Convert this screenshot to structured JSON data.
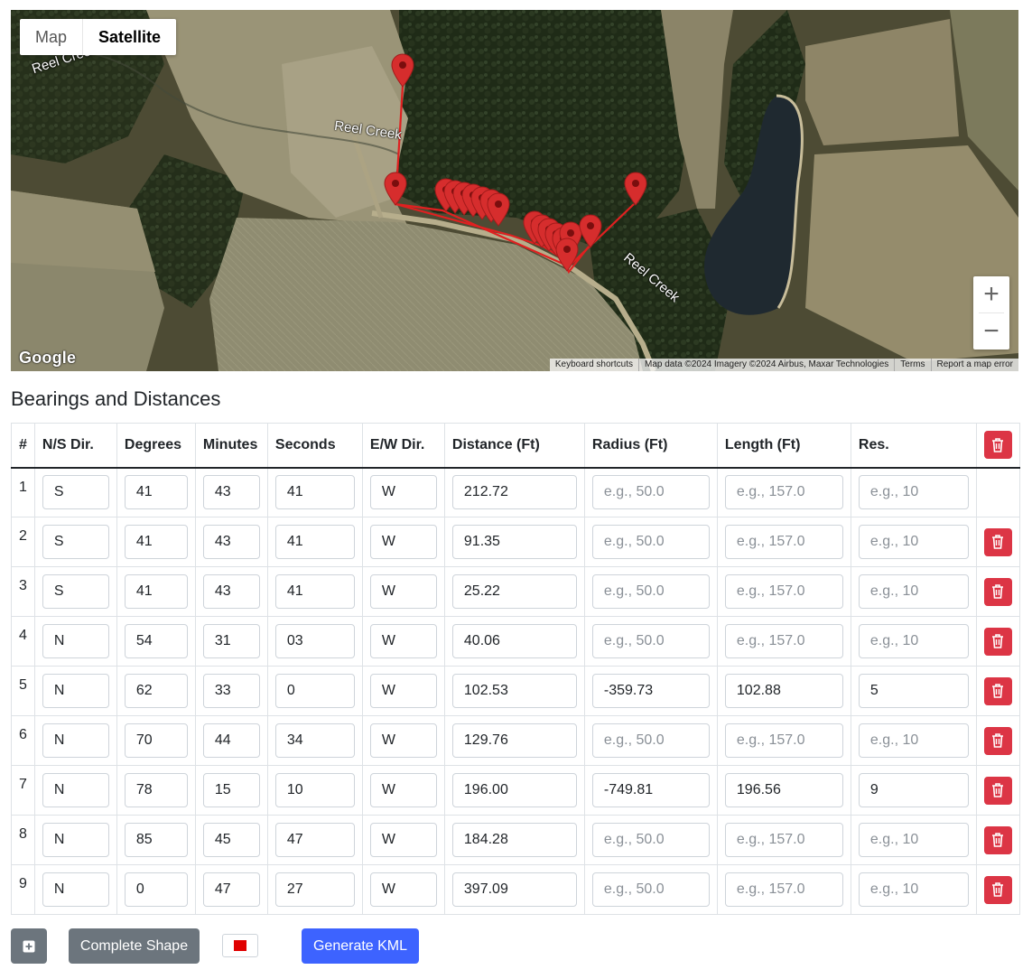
{
  "map": {
    "type_control": {
      "map_label": "Map",
      "satellite_label": "Satellite",
      "active": "Satellite"
    },
    "zoom_in_label": "+",
    "zoom_out_label": "−",
    "logo_text": "Google",
    "labels": [
      "Reel Creek",
      "Reel Creek",
      "Reel Creek"
    ],
    "attribution": [
      "Keyboard shortcuts",
      "Map data ©2024 Imagery ©2024 Airbus, Maxar Technologies",
      "Terms",
      "Report a map error"
    ],
    "marker_color": "#d62d2d",
    "line_color": "#e02020"
  },
  "section_title": "Bearings and Distances",
  "table": {
    "headers": [
      "#",
      "N/S Dir.",
      "Degrees",
      "Minutes",
      "Seconds",
      "E/W Dir.",
      "Distance (Ft)",
      "Radius (Ft)",
      "Length (Ft)",
      "Res."
    ],
    "placeholders": {
      "radius": "e.g., 50.0",
      "length": "e.g., 157.0",
      "res": "e.g., 10"
    },
    "rows": [
      {
        "num": "1",
        "ns": "S",
        "deg": "41",
        "min": "43",
        "sec": "41",
        "ew": "W",
        "dist": "212.72",
        "radius": "",
        "length": "",
        "res": ""
      },
      {
        "num": "2",
        "ns": "S",
        "deg": "41",
        "min": "43",
        "sec": "41",
        "ew": "W",
        "dist": "91.35",
        "radius": "",
        "length": "",
        "res": ""
      },
      {
        "num": "3",
        "ns": "S",
        "deg": "41",
        "min": "43",
        "sec": "41",
        "ew": "W",
        "dist": "25.22",
        "radius": "",
        "length": "",
        "res": ""
      },
      {
        "num": "4",
        "ns": "N",
        "deg": "54",
        "min": "31",
        "sec": "03",
        "ew": "W",
        "dist": "40.06",
        "radius": "",
        "length": "",
        "res": ""
      },
      {
        "num": "5",
        "ns": "N",
        "deg": "62",
        "min": "33",
        "sec": "0",
        "ew": "W",
        "dist": "102.53",
        "radius": "-359.73",
        "length": "102.88",
        "res": "5"
      },
      {
        "num": "6",
        "ns": "N",
        "deg": "70",
        "min": "44",
        "sec": "34",
        "ew": "W",
        "dist": "129.76",
        "radius": "",
        "length": "",
        "res": ""
      },
      {
        "num": "7",
        "ns": "N",
        "deg": "78",
        "min": "15",
        "sec": "10",
        "ew": "W",
        "dist": "196.00",
        "radius": "-749.81",
        "length": "196.56",
        "res": "9"
      },
      {
        "num": "8",
        "ns": "N",
        "deg": "85",
        "min": "45",
        "sec": "47",
        "ew": "W",
        "dist": "184.28",
        "radius": "",
        "length": "",
        "res": ""
      },
      {
        "num": "9",
        "ns": "N",
        "deg": "0",
        "min": "47",
        "sec": "27",
        "ew": "W",
        "dist": "397.09",
        "radius": "",
        "length": "",
        "res": ""
      }
    ],
    "delete_color": "#dc3545"
  },
  "buttons": {
    "add_icon": "plus-square-icon",
    "complete_label": "Complete Shape",
    "color_value": "#e00000",
    "generate_label": "Generate KML"
  }
}
